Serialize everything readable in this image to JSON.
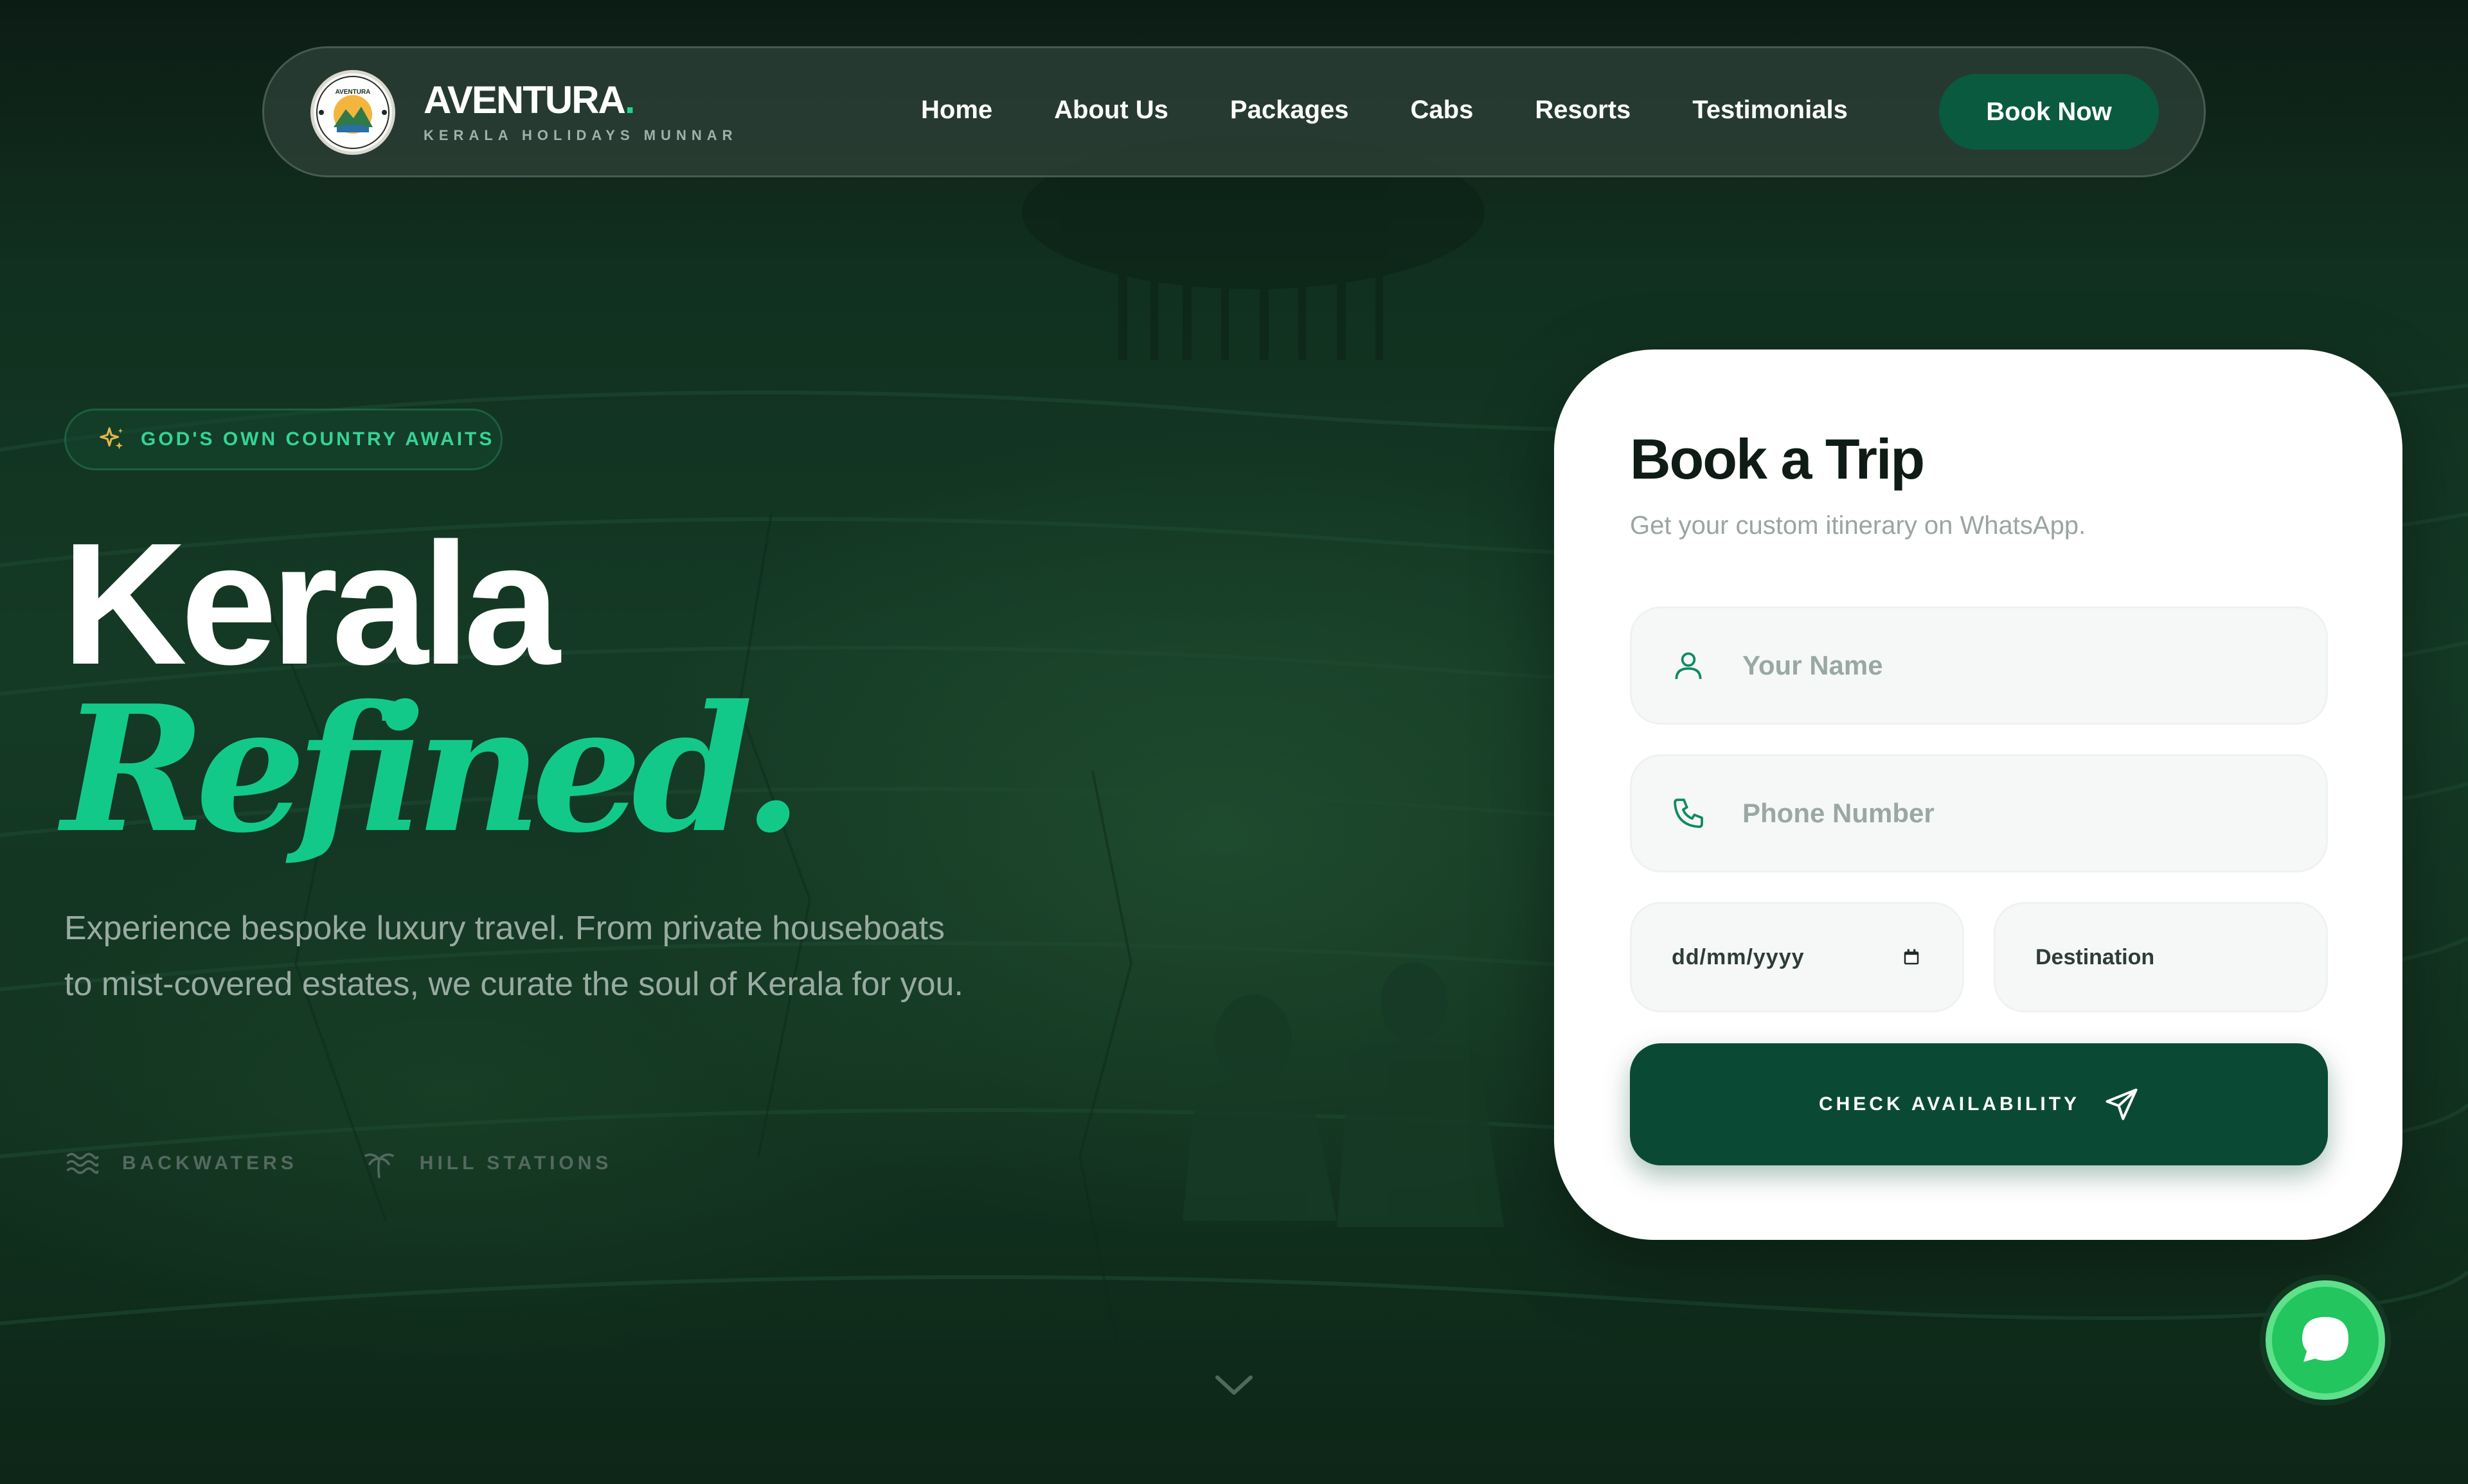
{
  "brand": {
    "name": "AVENTURA",
    "dot": ".",
    "tagline": "KERALA HOLIDAYS MUNNAR",
    "logo_text": "AVENTURA"
  },
  "nav": {
    "links": [
      "Home",
      "About Us",
      "Packages",
      "Cabs",
      "Resorts",
      "Testimonials"
    ],
    "cta": "Book Now"
  },
  "hero": {
    "tag": "GOD'S OWN COUNTRY AWAITS",
    "headline_line1": "Kerala",
    "headline_line2": "Refined.",
    "description": "Experience bespoke luxury travel. From private houseboats to mist-covered estates, we curate the soul of Kerala for you.",
    "features": [
      {
        "icon": "waves-icon",
        "label": "BACKWATERS"
      },
      {
        "icon": "palm-tree-icon",
        "label": "HILL STATIONS"
      }
    ]
  },
  "booking": {
    "title": "Book a Trip",
    "subtitle": "Get your custom itinerary on WhatsApp.",
    "name_placeholder": "Your Name",
    "phone_placeholder": "Phone Number",
    "date_placeholder": "dd/mm/yyyy",
    "destination_placeholder": "Destination",
    "submit_label": "CHECK AVAILABILITY"
  },
  "colors": {
    "accent_green": "#13c98a",
    "button_dark_green": "#0a4a35",
    "nav_cta_green": "#0a5a3f",
    "whatsapp_green": "#22c55e",
    "sparkle_gold": "#e8b64a"
  },
  "icons": {
    "scroll": "chevron-down-icon",
    "chat": "whatsapp-chat-icon",
    "tag": "sparkle-icon",
    "name_field": "user-icon",
    "phone_field": "phone-icon",
    "date_field": "calendar-icon",
    "submit": "send-icon"
  }
}
